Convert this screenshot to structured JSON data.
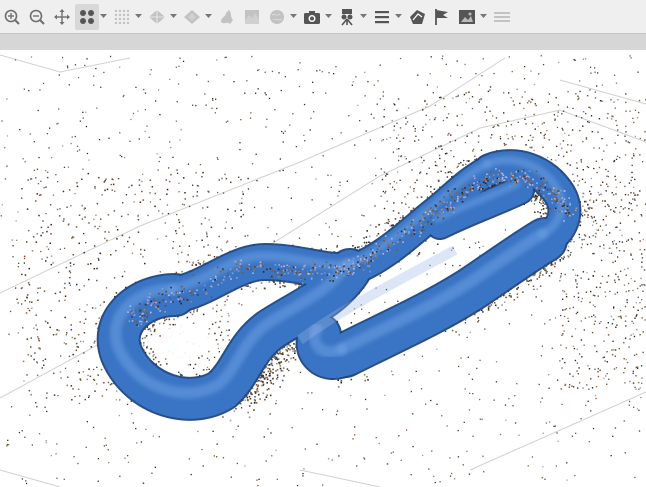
{
  "toolbar": {
    "buttons": [
      {
        "icon": "zoom-in-icon",
        "dropdown": false
      },
      {
        "icon": "zoom-out-icon",
        "dropdown": false
      },
      {
        "icon": "move-icon",
        "dropdown": false
      },
      {
        "icon": "points-icon",
        "dropdown": true,
        "active": true
      },
      {
        "icon": "dense-points-icon",
        "dropdown": true,
        "disabled": true
      },
      {
        "icon": "mesh-icon",
        "dropdown": true,
        "disabled": true
      },
      {
        "icon": "textured-mesh-icon",
        "dropdown": true,
        "disabled": true
      },
      {
        "icon": "tiled-model-icon",
        "dropdown": false,
        "disabled": true
      },
      {
        "icon": "dem-icon",
        "dropdown": false,
        "disabled": true
      },
      {
        "icon": "shaded-globe-icon",
        "dropdown": true,
        "disabled": true
      },
      {
        "icon": "camera-icon",
        "dropdown": true
      },
      {
        "icon": "projector-icon",
        "dropdown": true
      },
      {
        "icon": "menu-icon",
        "dropdown": true
      },
      {
        "icon": "region-icon",
        "dropdown": false
      },
      {
        "icon": "flag-icon",
        "dropdown": false
      },
      {
        "icon": "image-icon",
        "dropdown": true
      },
      {
        "icon": "layers-icon",
        "dropdown": false,
        "disabled": true
      }
    ]
  },
  "viewport": {
    "colors": {
      "model": "#3a74c4",
      "model_dark": "#24508e",
      "grid": "#c9c9c9",
      "background": "#ffffff"
    }
  }
}
